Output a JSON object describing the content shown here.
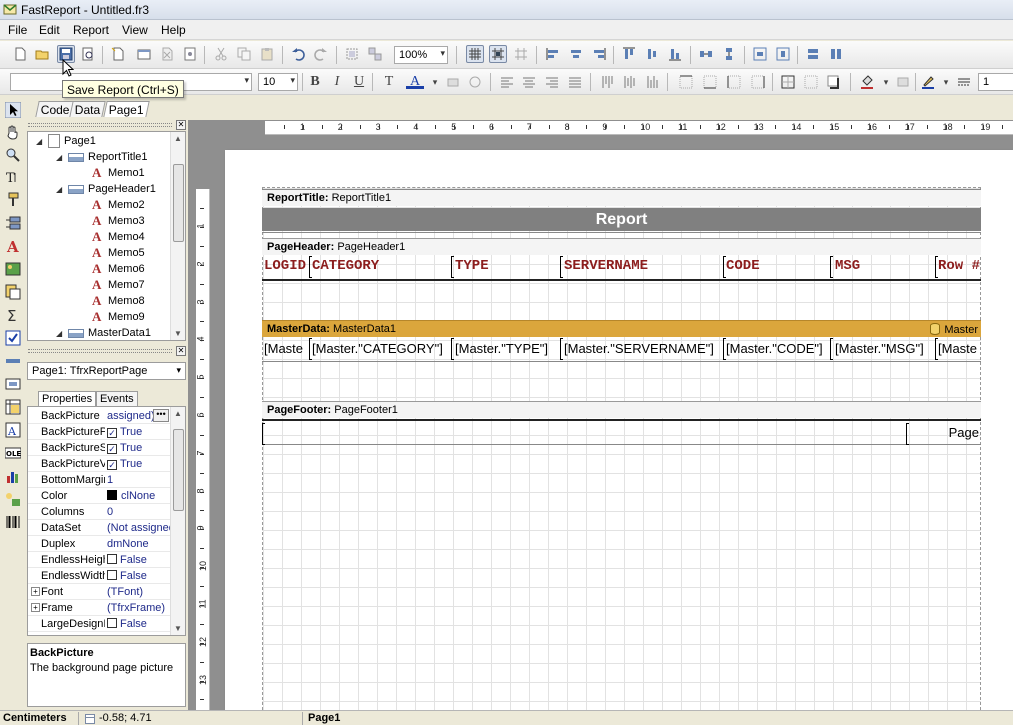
{
  "window": {
    "title": "FastReport - Untitled.fr3"
  },
  "menu": [
    "File",
    "Edit",
    "Report",
    "View",
    "Help"
  ],
  "toolbar": {
    "zoom": "100%",
    "font_name": "",
    "font_size": "10",
    "frame_width": "1"
  },
  "tooltip": "Save Report (Ctrl+S)",
  "page_tabs": [
    "Code",
    "Data",
    "Page1"
  ],
  "tree": {
    "items": [
      {
        "label": "Page1"
      },
      {
        "label": "ReportTitle1"
      },
      {
        "label": "Memo1"
      },
      {
        "label": "PageHeader1"
      },
      {
        "label": "Memo2"
      },
      {
        "label": "Memo3"
      },
      {
        "label": "Memo4"
      },
      {
        "label": "Memo5"
      },
      {
        "label": "Memo6"
      },
      {
        "label": "Memo7"
      },
      {
        "label": "Memo8"
      },
      {
        "label": "Memo9"
      },
      {
        "label": "MasterData1"
      }
    ]
  },
  "object_selector": "Page1: TfrxReportPage",
  "inspector": {
    "tabs": [
      "Properties",
      "Events"
    ],
    "rows": [
      {
        "name": "BackPicture",
        "value": "assigned)"
      },
      {
        "name": "BackPictureP",
        "value": "True"
      },
      {
        "name": "BackPictureS",
        "value": "True"
      },
      {
        "name": "BackPictureV",
        "value": "True"
      },
      {
        "name": "BottomMargin",
        "value": "1"
      },
      {
        "name": "Color",
        "value": "clNone"
      },
      {
        "name": "Columns",
        "value": "0"
      },
      {
        "name": "DataSet",
        "value": "(Not assigned)"
      },
      {
        "name": "Duplex",
        "value": "dmNone"
      },
      {
        "name": "EndlessHeigh",
        "value": "False"
      },
      {
        "name": "EndlessWidth",
        "value": "False"
      },
      {
        "name": "Font",
        "value": "(TFont)"
      },
      {
        "name": "Frame",
        "value": "(TfrxFrame)"
      },
      {
        "name": "LargeDesignI",
        "value": "False"
      }
    ],
    "description_title": "BackPicture",
    "description_text": "The background page picture"
  },
  "ruler": {
    "h_numbers": [
      "1",
      "2",
      "3",
      "4",
      "5",
      "6",
      "7",
      "8",
      "9",
      "10",
      "11",
      "12",
      "13",
      "14",
      "15",
      "16",
      "17",
      "18",
      "19"
    ],
    "v_numbers": [
      "1",
      "2",
      "3",
      "4",
      "5",
      "6",
      "7",
      "8",
      "9",
      "10",
      "11",
      "12",
      "13"
    ]
  },
  "report": {
    "report_title_band": {
      "type": "ReportTitle:",
      "name": "ReportTitle1",
      "text": "Report"
    },
    "page_header_band": {
      "type": "PageHeader:",
      "name": "PageHeader1"
    },
    "headers": [
      "LOGID",
      "CATEGORY",
      "TYPE",
      "SERVERNAME",
      "CODE",
      "MSG",
      "Row #"
    ],
    "master_band": {
      "type": "MasterData:",
      "name": "MasterData1",
      "dataset": "Master"
    },
    "master_cells": [
      "[Maste",
      "[Master.\"CATEGORY\"]",
      "[Master.\"TYPE\"]",
      "[Master.\"SERVERNAME\"]",
      "[Master.\"CODE\"]",
      "[Master.\"MSG\"]",
      "[Maste"
    ],
    "page_footer_band": {
      "type": "PageFooter:",
      "name": "PageFooter1",
      "text": "Page"
    }
  },
  "status": {
    "units": "Centimeters",
    "coords": "-0.58; 4.71",
    "page": "Page1"
  },
  "colors": {
    "header_text": "#8c1d1d",
    "report_title_bar": "#808080",
    "master_band": "#dba63c"
  }
}
